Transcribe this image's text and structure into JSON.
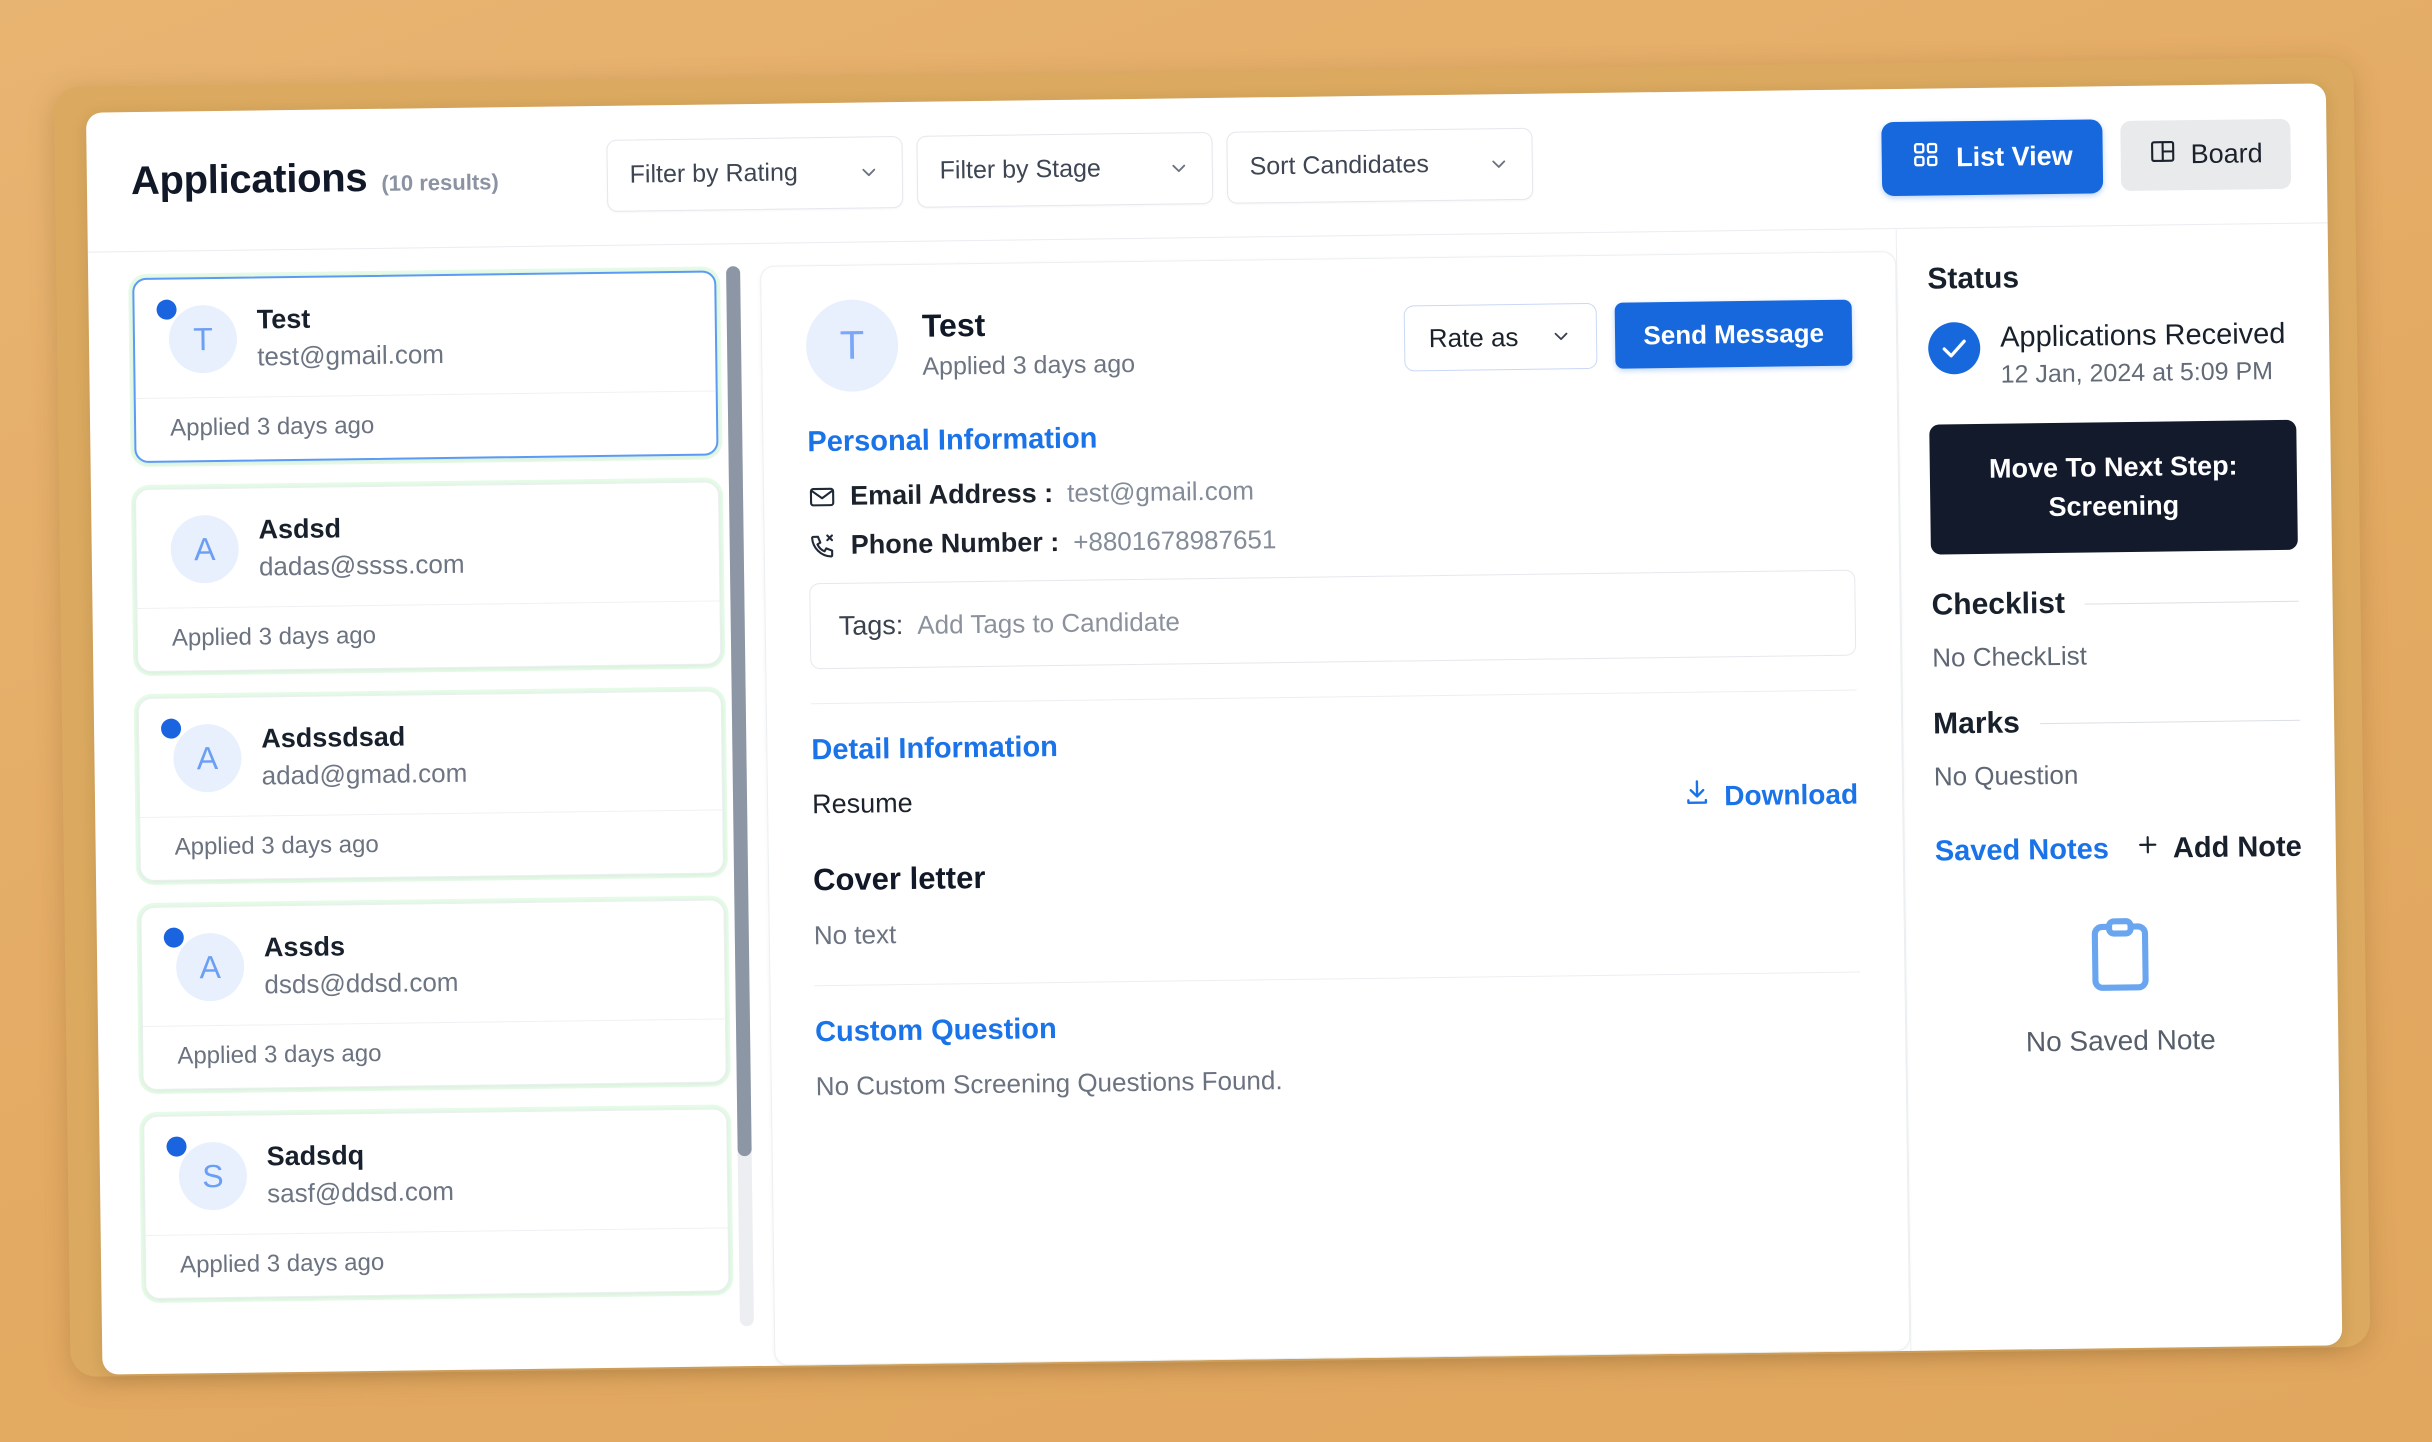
{
  "colors": {
    "page_background": "#e3aa63",
    "frame": "#dba95f",
    "accent_blue": "#1668dc",
    "link_blue": "#1a73e8",
    "dark_button": "#121a2b",
    "avatar_bg": "#e8f0fd",
    "status_dot": "#1a64e0"
  },
  "header": {
    "title": "Applications",
    "results": "(10 results)",
    "filters": [
      {
        "label": "Filter by Rating",
        "icon": "chevron-down-icon"
      },
      {
        "label": "Filter by Stage",
        "icon": "chevron-down-icon"
      },
      {
        "label": "Sort Candidates",
        "icon": "chevron-down-icon"
      }
    ],
    "view_buttons": {
      "list_view": {
        "label": "List View",
        "icon": "grid-icon"
      },
      "board": {
        "label": "Board",
        "icon": "board-icon"
      }
    }
  },
  "candidate_list": {
    "items": [
      {
        "initial": "T",
        "name": "Test",
        "email": "test@gmail.com",
        "applied": "Applied 3 days ago",
        "unread": true,
        "selected": true
      },
      {
        "initial": "A",
        "name": "Asdsd",
        "email": "dadas@ssss.com",
        "applied": "Applied 3 days ago",
        "unread": false,
        "selected": false
      },
      {
        "initial": "A",
        "name": "Asdssdsad",
        "email": "adad@gmad.com",
        "applied": "Applied 3 days ago",
        "unread": true,
        "selected": false
      },
      {
        "initial": "A",
        "name": "Assds",
        "email": "dsds@ddsd.com",
        "applied": "Applied 3 days ago",
        "unread": true,
        "selected": false
      },
      {
        "initial": "S",
        "name": "Sadsdq",
        "email": "sasf@ddsd.com",
        "applied": "Applied 3 days ago",
        "unread": true,
        "selected": false
      }
    ]
  },
  "detail": {
    "initial": "T",
    "name": "Test",
    "applied": "Applied 3 days ago",
    "rate_as": "Rate as",
    "send_message": "Send Message",
    "personal_information": {
      "heading": "Personal Information",
      "email_label": "Email Address :",
      "email_value": "test@gmail.com",
      "phone_label": "Phone Number :",
      "phone_value": "+8801678987651"
    },
    "tags": {
      "label": "Tags:",
      "placeholder": "Add Tags to Candidate",
      "value": ""
    },
    "detail_information": {
      "heading": "Detail Information",
      "resume_label": "Resume",
      "download_label": "Download"
    },
    "cover_letter": {
      "heading": "Cover letter",
      "body": "No text"
    },
    "custom_question": {
      "heading": "Custom Question",
      "body": "No Custom Screening Questions Found."
    }
  },
  "sidebar": {
    "status_title": "Status",
    "status_step": "Applications Received",
    "status_time": "12 Jan, 2024 at 5:09 PM",
    "next_step_line1": "Move To Next Step:",
    "next_step_line2": "Screening",
    "checklist": {
      "label": "Checklist",
      "empty": "No CheckList"
    },
    "marks": {
      "label": "Marks",
      "empty": "No Question"
    },
    "notes": {
      "title": "Saved Notes",
      "add_label": "Add Note",
      "empty": "No Saved Note"
    }
  }
}
